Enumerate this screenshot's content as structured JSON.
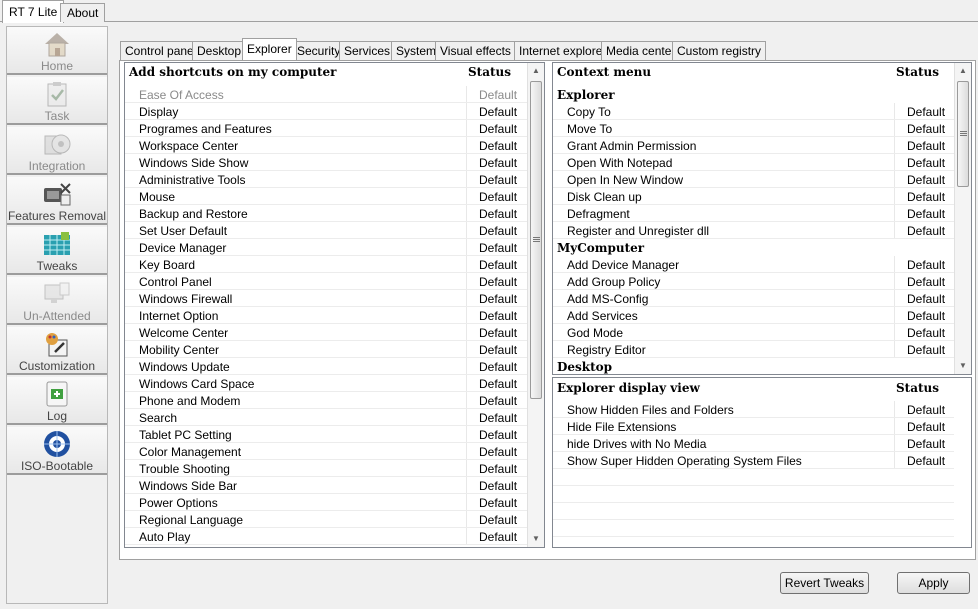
{
  "app_tabs": [
    "RT 7 Lite",
    "About"
  ],
  "sidebar": {
    "items": [
      {
        "label": "Home",
        "icon": "home-icon",
        "disabled": true
      },
      {
        "label": "Task",
        "icon": "task-icon",
        "disabled": true
      },
      {
        "label": "Integration",
        "icon": "integration-icon",
        "disabled": true
      },
      {
        "label": "Features Removal",
        "icon": "features-removal-icon",
        "disabled": false
      },
      {
        "label": "Tweaks",
        "icon": "tweaks-icon",
        "disabled": false
      },
      {
        "label": "Un-Attended",
        "icon": "unattended-icon",
        "disabled": true
      },
      {
        "label": "Customization",
        "icon": "customization-icon",
        "disabled": false
      },
      {
        "label": "Log",
        "icon": "log-icon",
        "disabled": false
      },
      {
        "label": "ISO-Bootable",
        "icon": "iso-bootable-icon",
        "disabled": false
      }
    ]
  },
  "subtabs": [
    "Control panel",
    "Desktop",
    "Explorer",
    "Security",
    "Services",
    "System",
    "Visual effects",
    "Internet explorer",
    "Media center",
    "Custom registry"
  ],
  "active_subtab": "Explorer",
  "shortcuts": {
    "header": "Add shortcuts on my computer",
    "status_header": "Status",
    "rows": [
      {
        "name": "Ease Of Access",
        "status": "Default"
      },
      {
        "name": "Display",
        "status": "Default"
      },
      {
        "name": "Programes and Features",
        "status": "Default"
      },
      {
        "name": "Workspace Center",
        "status": "Default"
      },
      {
        "name": "Windows Side Show",
        "status": "Default"
      },
      {
        "name": "Administrative Tools",
        "status": "Default"
      },
      {
        "name": "Mouse",
        "status": "Default"
      },
      {
        "name": "Backup and Restore",
        "status": "Default"
      },
      {
        "name": "Set User Default",
        "status": "Default"
      },
      {
        "name": "Device Manager",
        "status": "Default"
      },
      {
        "name": "Key Board",
        "status": "Default"
      },
      {
        "name": "Control Panel",
        "status": "Default"
      },
      {
        "name": "Windows Firewall",
        "status": "Default"
      },
      {
        "name": "Internet Option",
        "status": "Default"
      },
      {
        "name": "Welcome Center",
        "status": "Default"
      },
      {
        "name": "Mobility Center",
        "status": "Default"
      },
      {
        "name": "Windows Update",
        "status": "Default"
      },
      {
        "name": "Windows Card Space",
        "status": "Default"
      },
      {
        "name": "Phone and Modem",
        "status": "Default"
      },
      {
        "name": "Search",
        "status": "Default"
      },
      {
        "name": "Tablet PC Setting",
        "status": "Default"
      },
      {
        "name": "Color Management",
        "status": "Default"
      },
      {
        "name": "Trouble Shooting",
        "status": "Default"
      },
      {
        "name": "Windows Side Bar",
        "status": "Default"
      },
      {
        "name": "Power Options",
        "status": "Default"
      },
      {
        "name": "Regional Language",
        "status": "Default"
      },
      {
        "name": "Auto Play",
        "status": "Default"
      }
    ]
  },
  "context_menu": {
    "header": "Context menu",
    "status_header": "Status",
    "groups": [
      {
        "title": "Explorer",
        "rows": [
          {
            "name": "Copy To",
            "status": "Default"
          },
          {
            "name": "Move To",
            "status": "Default"
          },
          {
            "name": "Grant Admin Permission",
            "status": "Default"
          },
          {
            "name": "Open With Notepad",
            "status": "Default"
          },
          {
            "name": "Open In New Window",
            "status": "Default"
          },
          {
            "name": "Disk Clean up",
            "status": "Default"
          },
          {
            "name": "Defragment",
            "status": "Default"
          },
          {
            "name": "Register and Unregister dll",
            "status": "Default"
          }
        ]
      },
      {
        "title": "MyComputer",
        "rows": [
          {
            "name": "Add Device Manager",
            "status": "Default"
          },
          {
            "name": "Add Group Policy",
            "status": "Default"
          },
          {
            "name": "Add MS-Config",
            "status": "Default"
          },
          {
            "name": "Add Services",
            "status": "Default"
          },
          {
            "name": "God Mode",
            "status": "Default"
          },
          {
            "name": "Registry Editor",
            "status": "Default"
          }
        ]
      },
      {
        "title": "Desktop",
        "rows": []
      }
    ]
  },
  "display_view": {
    "header": "Explorer display view",
    "status_header": "Status",
    "rows": [
      {
        "name": "Show Hidden Files and Folders",
        "status": "Default"
      },
      {
        "name": "Hide File Extensions",
        "status": "Default"
      },
      {
        "name": "hide Drives with No Media",
        "status": "Default"
      },
      {
        "name": "Show Super Hidden Operating System Files",
        "status": "Default"
      }
    ]
  },
  "buttons": {
    "revert": "Revert Tweaks",
    "apply": "Apply"
  }
}
